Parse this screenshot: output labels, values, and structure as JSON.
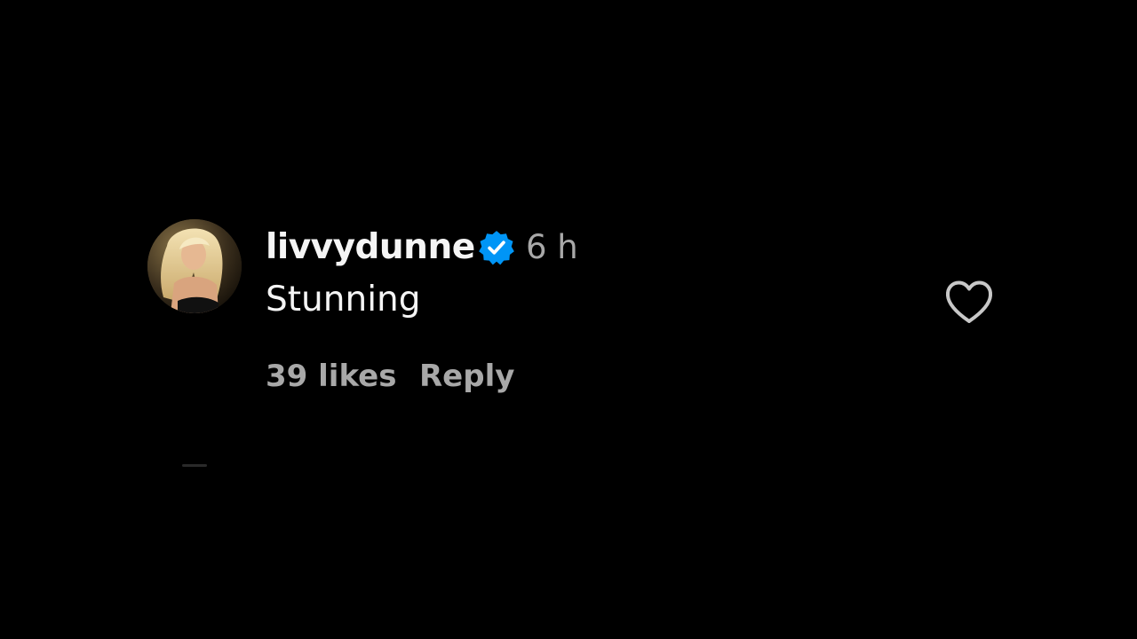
{
  "comment": {
    "username": "livvydunne",
    "verified": true,
    "timestamp": "6 h",
    "text": "Stunning",
    "likes_label": "39 likes",
    "reply_label": "Reply"
  },
  "icons": {
    "verified": "verified-badge-icon",
    "like": "heart-outline-icon"
  },
  "colors": {
    "background": "#000000",
    "primary_text": "#f5f5f5",
    "secondary_text": "#a8a8a8",
    "verified_badge": "#0095f6",
    "like_icon": "#c8c8c8"
  }
}
